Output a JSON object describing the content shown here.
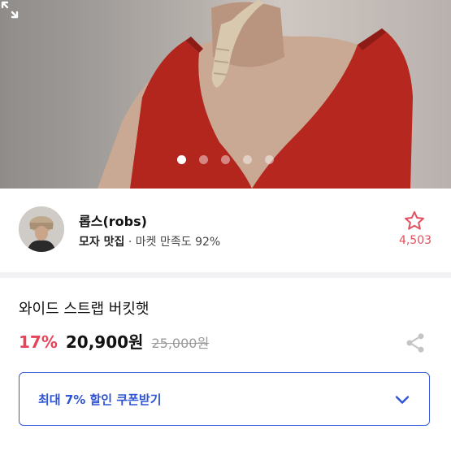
{
  "hero": {
    "image_desc": "photo-model-red-dress",
    "slides_count": 5,
    "active_slide": 0,
    "expand_icon": "expand-icon"
  },
  "seller": {
    "name": "롭스(robs)",
    "shop_tag": "모자 맛집",
    "separator": "·",
    "satisfaction": "마켓 만족도 92%",
    "favorite_icon": "star-outline-icon",
    "favorite_count": "4,503"
  },
  "product": {
    "title": "와이드 스트랩 버킷햇",
    "discount": "17%",
    "price": "20,900원",
    "original_price": "25,000원",
    "share_icon": "share-icon"
  },
  "coupon": {
    "label": "최대 7% 할인 쿠폰받기",
    "icon": "chevron-down-icon",
    "accent": "#2f55d4"
  },
  "colors": {
    "discount": "#e6445a",
    "favorite": "#e0505f",
    "coupon_border": "#3a5bd9"
  }
}
